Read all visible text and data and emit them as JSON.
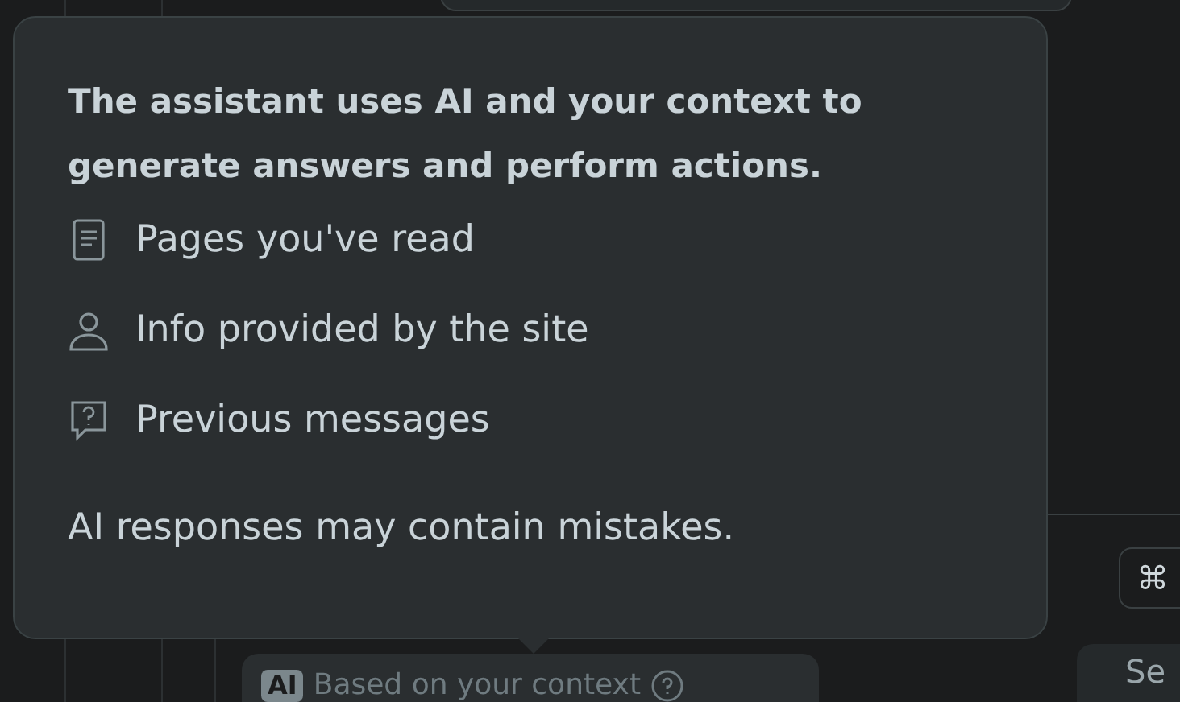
{
  "tooltip": {
    "heading": "The assistant uses AI and your context to generate answers and perform actions.",
    "items": [
      {
        "kind": "page",
        "label": "Pages you've read"
      },
      {
        "kind": "person",
        "label": "Info provided by the site"
      },
      {
        "kind": "question",
        "label": "Previous messages"
      }
    ],
    "disclaimer": "AI responses may contain mistakes."
  },
  "context_badge": {
    "tag": "AI",
    "label": "Based on your context"
  },
  "shortcut_key": "⌘",
  "send_button": "Se"
}
